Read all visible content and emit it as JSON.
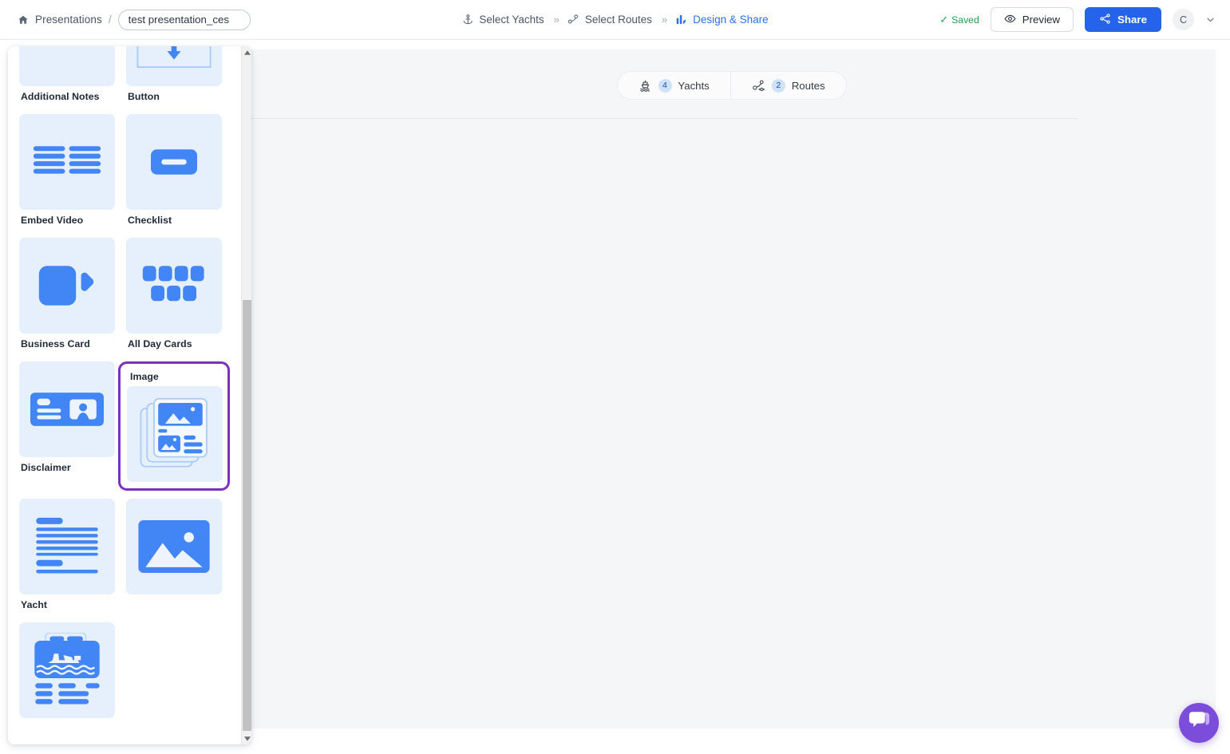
{
  "topbar": {
    "home_icon": "home-icon",
    "breadcrumb_link": "Presentations",
    "breadcrumb_separator": "/",
    "title_value": "test presentation_ces",
    "title_placeholder": "Presentation name",
    "steps": [
      {
        "label": "Select Yachts",
        "icon": "anchor-icon",
        "active": false
      },
      {
        "label": "Select Routes",
        "icon": "route-pin-icon",
        "active": false
      },
      {
        "label": "Design & Share",
        "icon": "design-bars-icon",
        "active": true
      }
    ],
    "step_separator": "»",
    "saved_tick": "✓",
    "saved_label": "Saved",
    "preview_label": "Preview",
    "preview_icon": "eye-icon",
    "share_label": "Share",
    "share_icon": "share-nodes-icon",
    "avatar_initial": "C",
    "caret_icon": "chevron-down-icon",
    "accent_color": "#2563eb",
    "saved_color": "#1f9d55"
  },
  "canvas": {
    "toggle": [
      {
        "icon": "yacht-icon",
        "count": "4",
        "label": "Yachts"
      },
      {
        "icon": "route-pin-icon",
        "count": "2",
        "label": "Routes"
      }
    ]
  },
  "panel": {
    "selected_border_color": "#7b31bd",
    "thumb_bg": "#e6f0fd",
    "icon_color": "#4285f4",
    "items": [
      {
        "label": "Additional Notes",
        "icon": "toolbar-bar-icon",
        "selected": false,
        "partial": true
      },
      {
        "label": "Button",
        "icon": "spacer-arrows-icon",
        "selected": false,
        "partial": true
      },
      {
        "label": "Embed Video",
        "icon": "text-columns-icon",
        "selected": false
      },
      {
        "label": "Checklist",
        "icon": "button-pill-icon",
        "selected": false
      },
      {
        "label": "Business Card",
        "icon": "video-camera-icon",
        "selected": false
      },
      {
        "label": "All Day Cards",
        "icon": "checklist-blocks-icon",
        "selected": false
      },
      {
        "label": "Disclaimer",
        "icon": "business-card-icon",
        "selected": false
      },
      {
        "label": "Image",
        "icon": "cards-stack-icon",
        "selected": true
      },
      {
        "label": "Yacht",
        "icon": "disclaimer-lines-icon",
        "selected": false
      }
    ],
    "scrollbar": {
      "up_icon": "scroll-up-arrow",
      "down_icon": "scroll-down-arrow"
    }
  },
  "chat": {
    "icon": "chat-bubble-icon",
    "color": "#7c4ddb"
  }
}
